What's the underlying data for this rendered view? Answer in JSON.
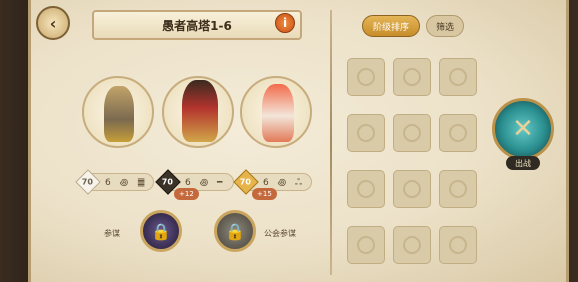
{
  "header": {
    "back_icon": "back-arrow-icon",
    "title": "愚者高塔1-6",
    "info_label": "i"
  },
  "toolbar": {
    "sort_label": "阶级排序",
    "filter_label": "筛选"
  },
  "heroes": [
    {
      "level": "70",
      "level_style": "white",
      "runes": "6 ꩜ ䷀",
      "bonus": ""
    },
    {
      "level": "70",
      "level_style": "dark",
      "runes": "6 ꩜ ━",
      "bonus": "+12"
    },
    {
      "level": "70",
      "level_style": "gold",
      "runes": "6 ꩜ ஃ",
      "bonus": "+15"
    }
  ],
  "pets": {
    "left_label": "参谋",
    "right_label": "公会参谋"
  },
  "battle": {
    "label": "出战",
    "icon": "crossed-swords-icon"
  },
  "roster_grid": {
    "rows": 4,
    "cols": 3
  }
}
